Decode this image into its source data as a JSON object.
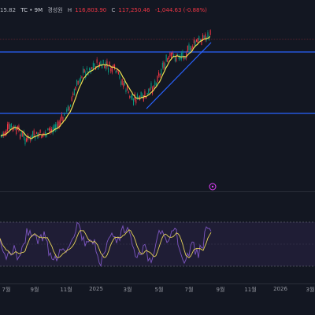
{
  "header": {
    "title": "TC • 9M",
    "extra": "경성원",
    "h_label": "H",
    "h_value": "116,803.90",
    "c_label": "C",
    "c_value": "117,250.46",
    "change": "-1,044.63 (-0.88%)",
    "prefix": "15.82"
  },
  "colors": {
    "background": "#131722",
    "channel_lines": "#2962ff",
    "trend_line": "#2962ff",
    "candle_up": "#089981",
    "candle_down": "#f23645",
    "moving_average": "#f0e050",
    "rsi_line": "#7e57c2",
    "rsi_fill": "#2a2345",
    "alert_marker": "#e040fb"
  },
  "rsi": {
    "ma_color": "#e6d35a"
  },
  "x_axis": {
    "labels": [
      "7월",
      "9월",
      "11월",
      "2025",
      "3월",
      "5월",
      "7월",
      "9월",
      "11월",
      "2026",
      "3월"
    ]
  }
}
